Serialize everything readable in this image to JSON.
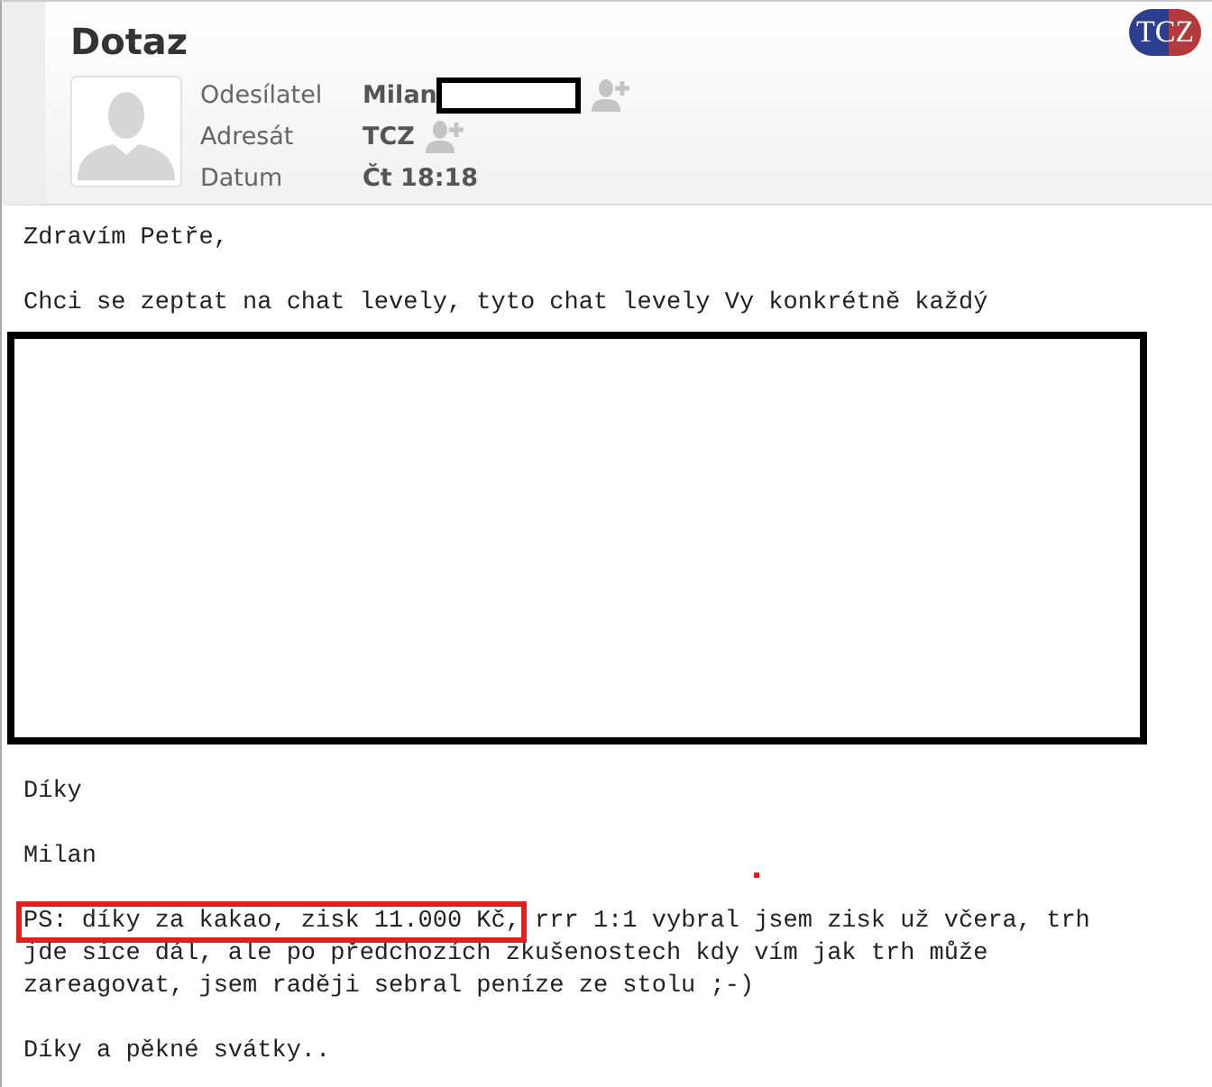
{
  "title": "Dotaz",
  "fields": [
    {
      "label": "Odesílatel",
      "value": "Milan",
      "redacted": true,
      "add_contact": true
    },
    {
      "label": "Adresát",
      "value": "TCZ",
      "redacted": false,
      "add_contact": true
    },
    {
      "label": "Datum",
      "value": "Čt 18:18",
      "redacted": false,
      "add_contact": false
    }
  ],
  "logo": "TCZ",
  "body": [
    {
      "kind": "text",
      "text": "Zdravím Petře,"
    },
    {
      "kind": "text",
      "text": "Chci se zeptat na chat levely, tyto chat levely Vy konkrétně každý"
    },
    {
      "kind": "redaction"
    },
    {
      "kind": "text",
      "text": "Díky"
    },
    {
      "kind": "text",
      "text": "Milan"
    },
    {
      "kind": "highlight",
      "highlighted": "PS: díky za kakao, zisk 11.000 Kč,",
      "rest": "rrr 1:1 vybral jsem zisk už včera, trh jde sice dál, ale po předchozích zkušenostech kdy vím jak trh může zareagovat, jsem raději sebral peníze ze stolu ;-)"
    },
    {
      "kind": "text",
      "text": "Díky a pěkné svátky.."
    }
  ]
}
